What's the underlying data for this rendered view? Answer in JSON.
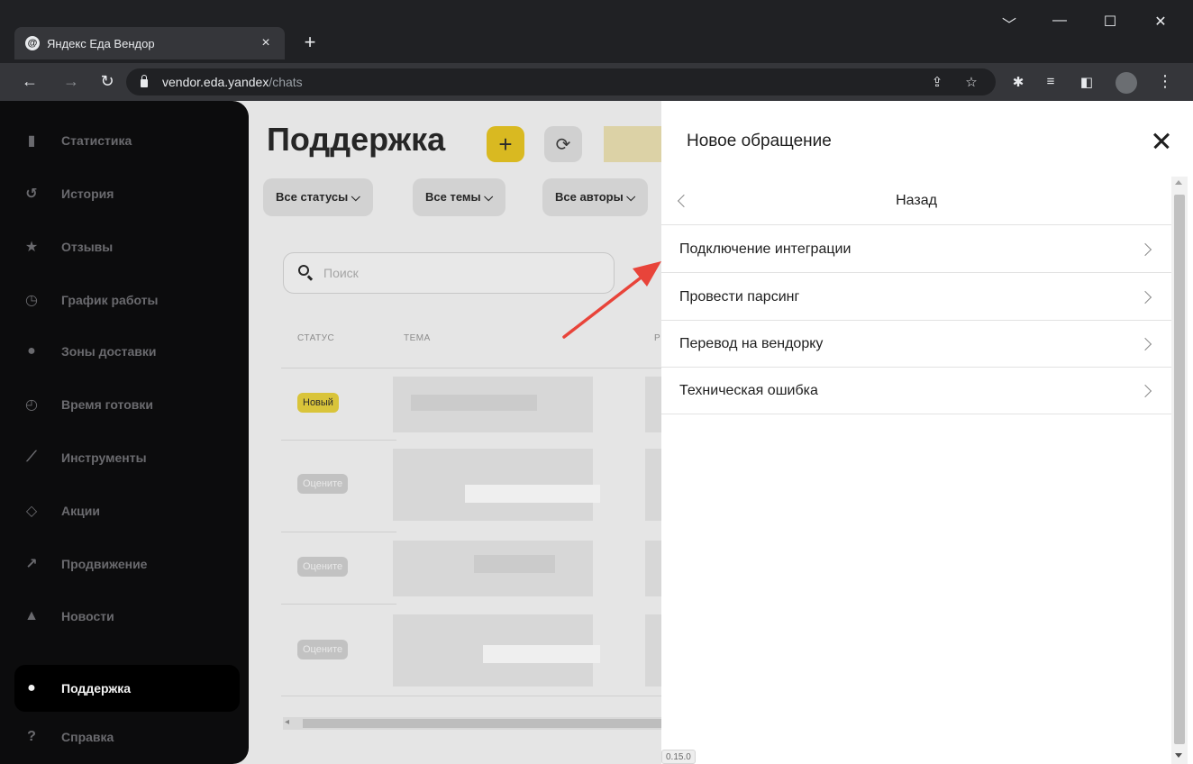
{
  "browser": {
    "tab_title": "Яндекс Еда Вендор",
    "tab_favicon": "@",
    "tab_close": "×",
    "new_tab": "+",
    "url_host": "vendor.eda.yandex",
    "url_path": "/chats",
    "window_controls": [
      "﹀",
      "—",
      "☐",
      "✕"
    ]
  },
  "sidebar": {
    "items": [
      {
        "label": "Статистика",
        "icon": "bar-chart-icon",
        "glyph": "▮"
      },
      {
        "label": "История",
        "icon": "history-icon",
        "glyph": "↺"
      },
      {
        "label": "Отзывы",
        "icon": "star-bubble-icon",
        "glyph": "★"
      },
      {
        "label": "График работы",
        "icon": "clock-icon",
        "glyph": "◷"
      },
      {
        "label": "Зоны доставки",
        "icon": "map-pin-icon",
        "glyph": "●"
      },
      {
        "label": "Время готовки",
        "icon": "stopwatch-icon",
        "glyph": "◴"
      },
      {
        "label": "Инструменты",
        "icon": "tools-icon",
        "glyph": "⟋"
      },
      {
        "label": "Акции",
        "icon": "tag-icon",
        "glyph": "◇"
      },
      {
        "label": "Продвижение",
        "icon": "trend-up-icon",
        "glyph": "↗"
      },
      {
        "label": "Новости",
        "icon": "bell-icon",
        "glyph": "▲"
      },
      {
        "label": "Поддержка",
        "icon": "chat-icon",
        "glyph": "●"
      },
      {
        "label": "Справка",
        "icon": "help-icon",
        "glyph": "?"
      }
    ],
    "active": "Поддержка"
  },
  "main": {
    "title": "Поддержка",
    "add_glyph": "+",
    "refresh_glyph": "⟳",
    "filters": [
      "Все статусы ⌵",
      "Все темы ⌵",
      "Все авторы ⌵"
    ],
    "search_placeholder": "Поиск",
    "columns": [
      "СТАТУС",
      "ТЕМА",
      "Р"
    ],
    "rows": [
      {
        "status": "Новый",
        "kind": "new"
      },
      {
        "status": "Оцените",
        "kind": "rate"
      },
      {
        "status": "Оцените",
        "kind": "rate"
      },
      {
        "status": "Оцените",
        "kind": "rate"
      }
    ],
    "scroll_left_glyph": "◂"
  },
  "drawer": {
    "title": "Новое обращение",
    "back_label": "Назад",
    "items": [
      "Подключение интеграции",
      "Провести парсинг",
      "Перевод на вендорку",
      "Техническая ошибка"
    ],
    "version": "0.15.0"
  },
  "colors": {
    "accent_yellow": "#d9b921",
    "annotation_arrow": "#e8443a",
    "sidebar_bg": "#0c0c0d"
  }
}
